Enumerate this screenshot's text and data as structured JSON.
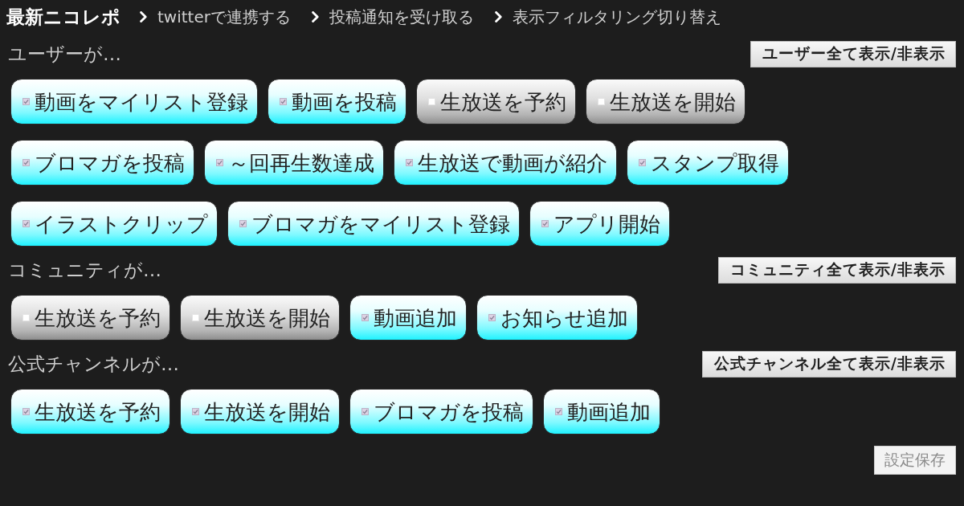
{
  "header": {
    "title": "最新ニコレポ",
    "links": [
      "twitterで連携する",
      "投稿通知を受け取る",
      "表示フィルタリング切り替え"
    ]
  },
  "sections": [
    {
      "heading": "ユーザーが…",
      "toggle_button": "ユーザー全て表示/非表示",
      "items": [
        {
          "label": "動画をマイリスト登録",
          "checked": true
        },
        {
          "label": "動画を投稿",
          "checked": true
        },
        {
          "label": "生放送を予約",
          "checked": false
        },
        {
          "label": "生放送を開始",
          "checked": false
        },
        {
          "label": "ブロマガを投稿",
          "checked": true
        },
        {
          "label": "～回再生数達成",
          "checked": true
        },
        {
          "label": "生放送で動画が紹介",
          "checked": true
        },
        {
          "label": "スタンプ取得",
          "checked": true
        },
        {
          "label": "イラストクリップ",
          "checked": true
        },
        {
          "label": "ブロマガをマイリスト登録",
          "checked": true
        },
        {
          "label": "アプリ開始",
          "checked": true
        }
      ]
    },
    {
      "heading": "コミュニティが…",
      "toggle_button": "コミュニティ全て表示/非表示",
      "items": [
        {
          "label": "生放送を予約",
          "checked": false
        },
        {
          "label": "生放送を開始",
          "checked": false
        },
        {
          "label": "動画追加",
          "checked": true
        },
        {
          "label": "お知らせ追加",
          "checked": true
        }
      ]
    },
    {
      "heading": "公式チャンネルが…",
      "toggle_button": "公式チャンネル全て表示/非表示",
      "items": [
        {
          "label": "生放送を予約",
          "checked": true
        },
        {
          "label": "生放送を開始",
          "checked": true
        },
        {
          "label": "ブロマガを投稿",
          "checked": true
        },
        {
          "label": "動画追加",
          "checked": true
        }
      ]
    }
  ],
  "save_button": {
    "label": "設定保存",
    "disabled": true
  }
}
